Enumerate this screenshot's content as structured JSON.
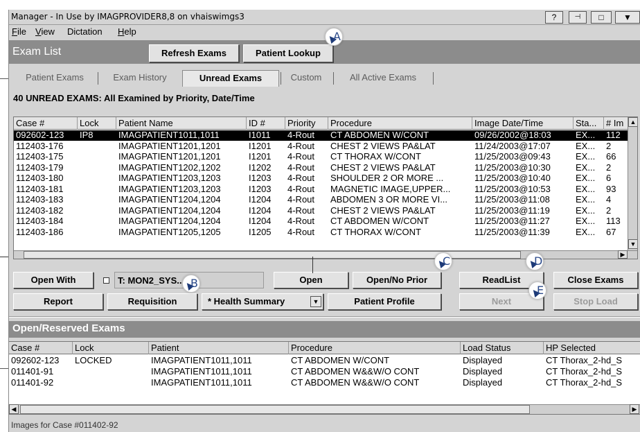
{
  "window": {
    "title": "Manager - In Use by IMAGPROVIDER8,8 on vhaiswimgs3",
    "buttons": {
      "help": "?",
      "pin": "⊣⊢",
      "maximize": "□",
      "menu": "▼"
    }
  },
  "menu": [
    {
      "label": "File",
      "u": "F",
      "rest": "ile"
    },
    {
      "label": "View",
      "u": "V",
      "rest": "iew"
    },
    {
      "label": "Dictation",
      "u": "",
      "rest": "Dictation"
    },
    {
      "label": "Help",
      "u": "H",
      "rest": "elp"
    }
  ],
  "exam_list": {
    "header": "Exam List",
    "refresh_label": "Refresh Exams",
    "lookup_label": "Patient Lookup"
  },
  "tabs": [
    "Patient Exams",
    "Exam History",
    "Unread Exams",
    "Custom",
    "All Active Exams"
  ],
  "active_tab": "Unread Exams",
  "info_text": "40 UNREAD EXAMS: All Examined by Priority, Date/Time",
  "exam_table": {
    "columns": [
      "Case #",
      "Lock",
      "Patient Name",
      "ID #",
      "Priority",
      "Procedure",
      "Image Date/Time",
      "Sta...",
      "# Im"
    ],
    "rows": [
      [
        "092602-123",
        "IP8",
        "IMAGPATIENT1011,1011",
        "I1011",
        "4-Rout",
        "CT ABDOMEN W/CONT",
        "09/26/2002@18:03",
        "EX...",
        "112"
      ],
      [
        "112403-176",
        "",
        "IMAGPATIENT1201,1201",
        "I1201",
        "4-Rout",
        "CHEST 2 VIEWS PA&LAT",
        "11/24/2003@17:07",
        "EX...",
        "2"
      ],
      [
        "112403-175",
        "",
        "IMAGPATIENT1201,1201",
        "I1201",
        "4-Rout",
        "CT THORAX W/CONT",
        "11/25/2003@09:43",
        "EX...",
        "66"
      ],
      [
        "112403-179",
        "",
        "IMAGPATIENT1202,1202",
        "I1202",
        "4-Rout",
        "CHEST 2 VIEWS PA&LAT",
        "11/25/2003@10:30",
        "EX...",
        "2"
      ],
      [
        "112403-180",
        "",
        "IMAGPATIENT1203,1203",
        "I1203",
        "4-Rout",
        "SHOULDER 2 OR MORE ...",
        "11/25/2003@10:40",
        "EX...",
        "6"
      ],
      [
        "112403-181",
        "",
        "IMAGPATIENT1203,1203",
        "I1203",
        "4-Rout",
        "MAGNETIC IMAGE,UPPER...",
        "11/25/2003@10:53",
        "EX...",
        "93"
      ],
      [
        "112403-183",
        "",
        "IMAGPATIENT1204,1204",
        "I1204",
        "4-Rout",
        "ABDOMEN 3 OR MORE VI...",
        "11/25/2003@11:08",
        "EX...",
        "4"
      ],
      [
        "112403-182",
        "",
        "IMAGPATIENT1204,1204",
        "I1204",
        "4-Rout",
        "CHEST 2 VIEWS PA&LAT",
        "11/25/2003@11:19",
        "EX...",
        "2"
      ],
      [
        "112403-184",
        "",
        "IMAGPATIENT1204,1204",
        "I1204",
        "4-Rout",
        "CT ABDOMEN W/CONT",
        "11/25/2003@11:27",
        "EX...",
        "113"
      ],
      [
        "112403-186",
        "",
        "IMAGPATIENT1205,1205",
        "I1205",
        "4-Rout",
        "CT THORAX W/CONT",
        "11/25/2003@11:39",
        "EX...",
        "67"
      ]
    ]
  },
  "actions": {
    "open_with": "Open With",
    "station": "T: MON2_SYS...",
    "open": "Open",
    "open_no_prior": "Open/No Prior",
    "readlist": "ReadList",
    "close_exams": "Close Exams",
    "report": "Report",
    "requisition": "Requisition",
    "health_summary": "* Health Summary",
    "patient_profile": "Patient Profile",
    "next": "Next",
    "stop_load": "Stop Load"
  },
  "open_reserved": {
    "header": "Open/Reserved Exams",
    "columns": [
      "Case #",
      "Lock",
      "Patient",
      "Procedure",
      "Load Status",
      "HP Selected"
    ],
    "rows": [
      [
        "092602-123",
        "LOCKED",
        "IMAGPATIENT1011,1011",
        "CT ABDOMEN W/CONT",
        "Displayed",
        "CT Thorax_2-hd_S"
      ],
      [
        "011401-91",
        "",
        "IMAGPATIENT1011,1011",
        "CT ABDOMEN W&&W/O CONT",
        "Displayed",
        "CT Thorax_2-hd_S"
      ],
      [
        "011401-92",
        "",
        "IMAGPATIENT1011,1011",
        "CT ABDOMEN W&&W/O CONT",
        "Displayed",
        "CT Thorax_2-hd_S"
      ]
    ]
  },
  "status_text": "Images for Case #011402-92",
  "callouts": [
    "A",
    "B",
    "C",
    "D",
    "E"
  ],
  "colors": {
    "header_bg": "#8c8c8c",
    "selected_row": "#000000",
    "callout_arrow": "#1d3a78"
  }
}
